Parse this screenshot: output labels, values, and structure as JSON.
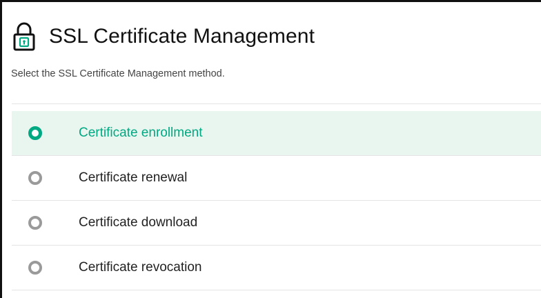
{
  "page": {
    "title": "SSL Certificate Management",
    "subtitle": "Select the SSL Certificate Management method.",
    "icon": "lock-icon"
  },
  "options": [
    {
      "label": "Certificate enrollment",
      "selected": true
    },
    {
      "label": "Certificate renewal",
      "selected": false
    },
    {
      "label": "Certificate download",
      "selected": false
    },
    {
      "label": "Certificate revocation",
      "selected": false
    }
  ],
  "colors": {
    "accent": "#01a982",
    "selected_background": "#e8f6ef",
    "radio_unselected": "#9a9a9a",
    "divider": "#e4e4e4"
  }
}
